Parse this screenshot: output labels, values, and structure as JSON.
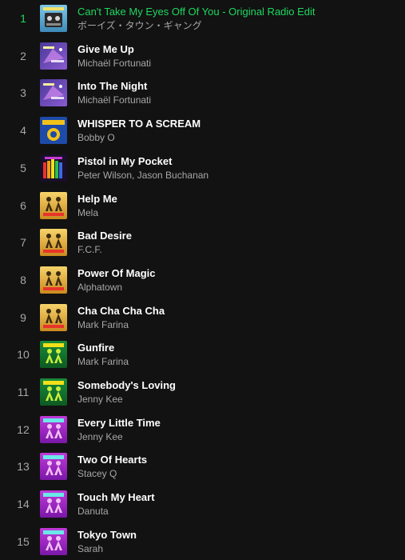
{
  "colors": {
    "background": "#121212",
    "text_primary": "#ffffff",
    "text_secondary": "#a7a7a7",
    "accent_playing": "#1ed760"
  },
  "tracks": [
    {
      "number": "1",
      "title": "Can't Take My Eyes Off Of You - Original Radio Edit",
      "artist": "ボーイズ・タウン・ギャング",
      "playing": true,
      "cover": "cover-boys-town-gang"
    },
    {
      "number": "2",
      "title": "Give Me Up",
      "artist": "Michaël Fortunati",
      "playing": false,
      "cover": "cover-purple-space"
    },
    {
      "number": "3",
      "title": "Into The Night",
      "artist": "Michaël Fortunati",
      "playing": false,
      "cover": "cover-purple-space"
    },
    {
      "number": "4",
      "title": "WHISPER TO A SCREAM",
      "artist": "Bobby O",
      "playing": false,
      "cover": "cover-blue-yellow"
    },
    {
      "number": "5",
      "title": "Pistol in My Pocket",
      "artist": "Peter Wilson, Jason Buchanan",
      "playing": false,
      "cover": "cover-rainbow-dark"
    },
    {
      "number": "6",
      "title": "Help Me",
      "artist": "Mela",
      "playing": false,
      "cover": "cover-gold-dancers"
    },
    {
      "number": "7",
      "title": "Bad Desire",
      "artist": "F.C.F.",
      "playing": false,
      "cover": "cover-gold-dancers"
    },
    {
      "number": "8",
      "title": "Power Of Magic",
      "artist": "Alphatown",
      "playing": false,
      "cover": "cover-gold-dancers"
    },
    {
      "number": "9",
      "title": "Cha Cha Cha Cha",
      "artist": "Mark Farina",
      "playing": false,
      "cover": "cover-gold-dancers"
    },
    {
      "number": "10",
      "title": "Gunfire",
      "artist": "Mark Farina",
      "playing": false,
      "cover": "cover-green-dancers"
    },
    {
      "number": "11",
      "title": "Somebody's Loving",
      "artist": "Jenny Kee",
      "playing": false,
      "cover": "cover-green-dancers"
    },
    {
      "number": "12",
      "title": "Every Little Time",
      "artist": "Jenny Kee",
      "playing": false,
      "cover": "cover-magenta-dancers"
    },
    {
      "number": "13",
      "title": "Two Of Hearts",
      "artist": "Stacey Q",
      "playing": false,
      "cover": "cover-magenta-dancers"
    },
    {
      "number": "14",
      "title": "Touch My Heart",
      "artist": "Danuta",
      "playing": false,
      "cover": "cover-magenta-dancers"
    },
    {
      "number": "15",
      "title": "Tokyo Town",
      "artist": "Sarah",
      "playing": false,
      "cover": "cover-magenta-dancers"
    }
  ]
}
